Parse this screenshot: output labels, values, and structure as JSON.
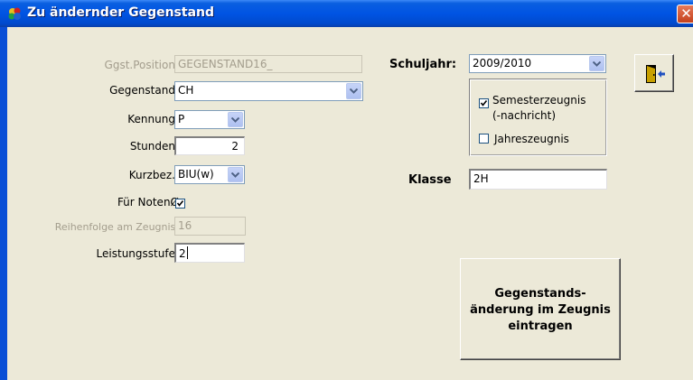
{
  "window": {
    "title": "Zu ändernder Gegenstand",
    "close_label": "✕"
  },
  "form": {
    "position": {
      "label": "Ggst.Position:",
      "value": "GEGENSTAND16_"
    },
    "gegenstand": {
      "label": "Gegenstand:",
      "value": "CH"
    },
    "kennung": {
      "label": "Kennung:",
      "value": "P"
    },
    "stunden": {
      "label": "Stunden:",
      "value": "2"
    },
    "kurzbez": {
      "label": "Kurzbez.:",
      "value": "BIU(w)"
    },
    "noten": {
      "label": "Für NotenØ",
      "checked": true
    },
    "reihenfolge": {
      "label": "Reihenfolge am Zeugnis:",
      "value": "16"
    },
    "leistungsstufe": {
      "label": "Leistungsstufe:",
      "value": "2"
    }
  },
  "right": {
    "schuljahr": {
      "label": "Schuljahr:",
      "value": "2009/2010"
    },
    "semester": {
      "label_line1": "Semesterzeugnis",
      "label_line2": "(-nachricht)",
      "checked": true
    },
    "jahres": {
      "label": "Jahreszeugnis",
      "checked": false
    },
    "klasse": {
      "label": "Klasse",
      "value": "2H"
    }
  },
  "buttons": {
    "save_label": "Gegenstands-\nänderung im Zeugnis\neintragen",
    "exit_icon": "exit-door-icon"
  },
  "colors": {
    "titlebar": "#0054e3",
    "dialog": "#ece9d8",
    "field_border": "#7f9db9"
  }
}
